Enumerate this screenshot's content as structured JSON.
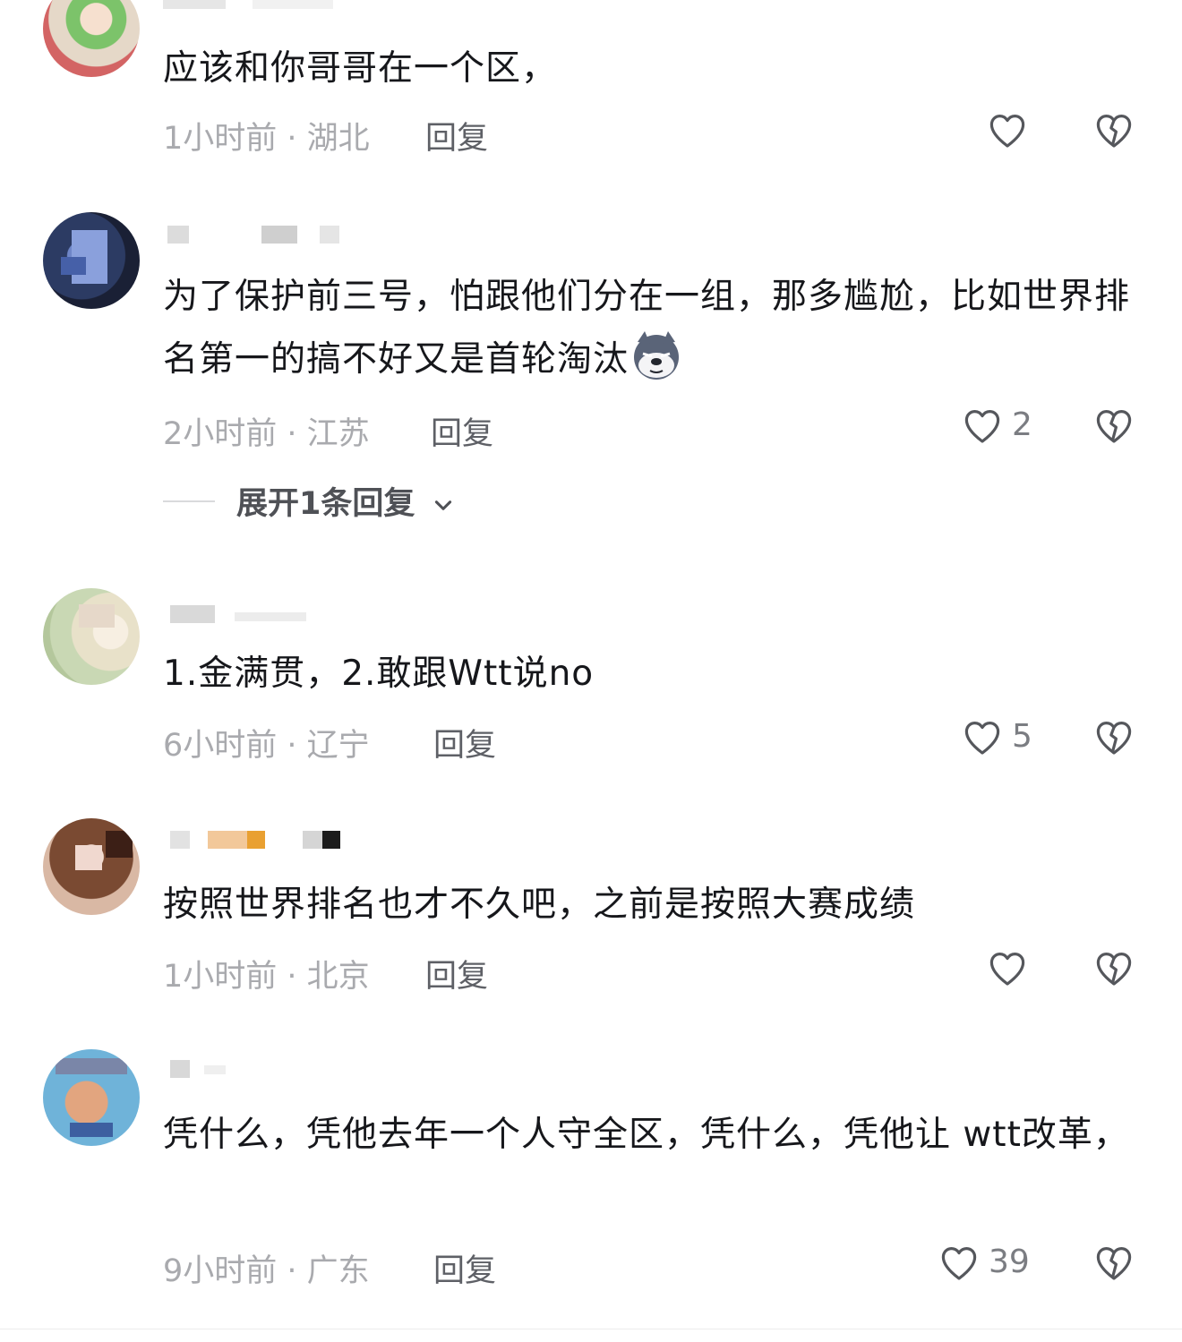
{
  "comments": [
    {
      "text": "应该和你哥哥在一个区，",
      "time": "1小时前",
      "location": "湖北",
      "reply_label": "回复",
      "likes": ""
    },
    {
      "text": "为了保护前三号，怕跟他们分在一组，那多尴尬，比如世界排名第一的搞不好又是首轮淘汰",
      "emoji": "wolf-face-emoji",
      "time": "2小时前",
      "location": "江苏",
      "reply_label": "回复",
      "likes": "2",
      "expand_label": "展开1条回复"
    },
    {
      "text": "1.金满贯，2.敢跟Wtt说no",
      "time": "6小时前",
      "location": "辽宁",
      "reply_label": "回复",
      "likes": "5"
    },
    {
      "text": "按照世界排名也才不久吧，之前是按照大赛成绩",
      "time": "1小时前",
      "location": "北京",
      "reply_label": "回复",
      "likes": ""
    },
    {
      "text": "凭什么，凭他去年一个人守全区，凭什么，凭他让 wtt改革，",
      "time": "9小时前",
      "location": "广东",
      "reply_label": "回复",
      "likes": "39"
    }
  ],
  "separator": " · ",
  "icons": {
    "like": "heart-outline-icon",
    "dislike": "broken-heart-icon",
    "expand": "chevron-down-icon"
  },
  "colors": {
    "text": "#16171b",
    "meta": "#a9aaae",
    "reply": "#5e6066",
    "icon": "#55575c"
  }
}
